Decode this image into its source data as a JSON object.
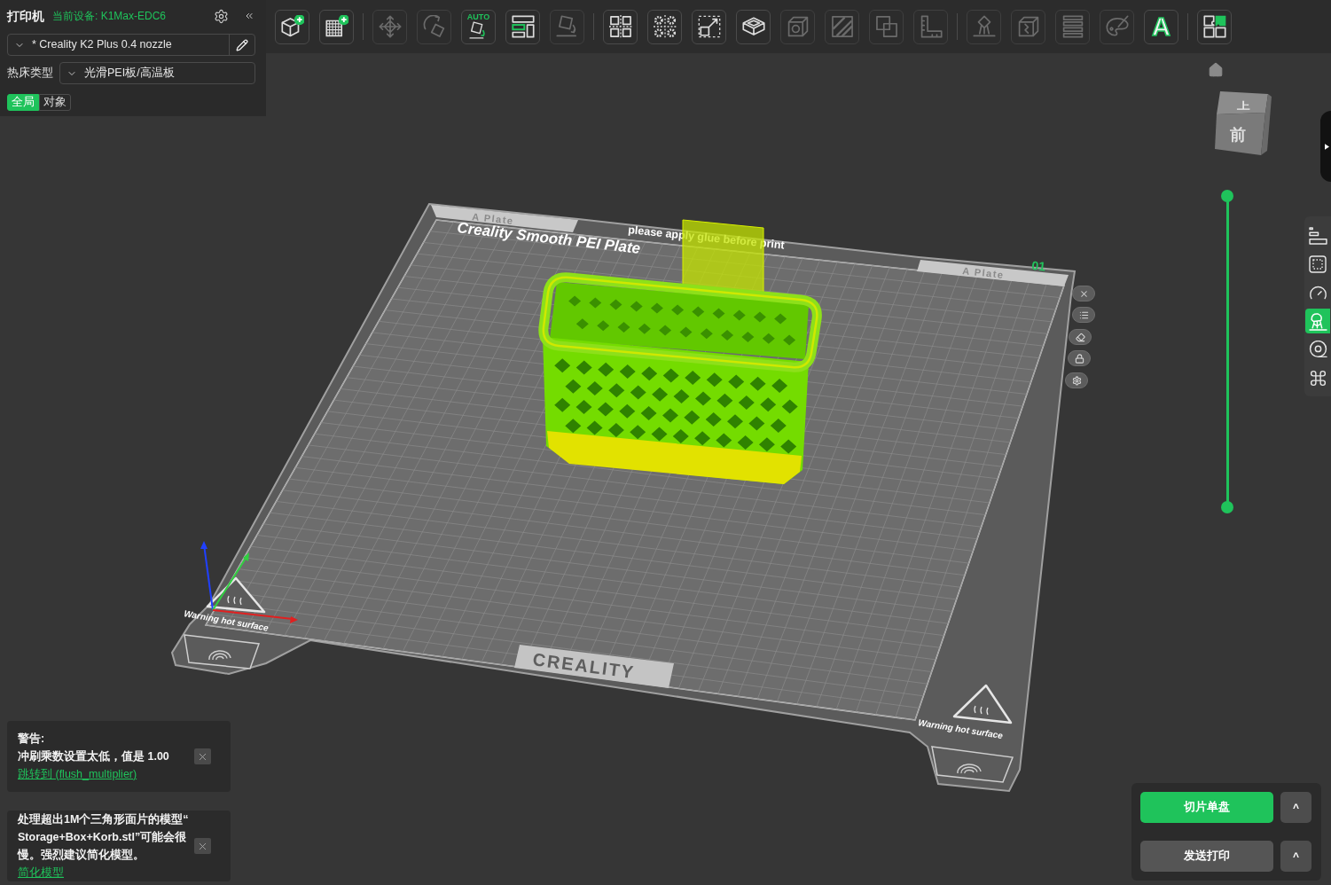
{
  "printer_panel": {
    "title": "打印机",
    "current_device": "当前设备: K1Max-EDC6",
    "preset": "* Creality K2 Plus 0.4 nozzle",
    "bed_type_label": "热床类型",
    "bed_type": "光滑PEI板/高温板",
    "scope_tabs": [
      {
        "label": "全局",
        "selected": true
      },
      {
        "label": "对象",
        "selected": false
      }
    ]
  },
  "toolbar": {
    "groups": [
      {
        "tools": [
          {
            "kind": "add-model",
            "disabled": false
          },
          {
            "kind": "add-plate",
            "disabled": false
          }
        ]
      },
      {
        "tools": [
          {
            "kind": "move",
            "disabled": true
          },
          {
            "kind": "rotate",
            "disabled": true
          },
          {
            "kind": "auto-orient",
            "label": "AUTO",
            "disabled": false
          },
          {
            "kind": "arrange",
            "disabled": false
          },
          {
            "kind": "lay-on-face",
            "disabled": true
          }
        ]
      },
      {
        "tools": [
          {
            "kind": "split-objects",
            "disabled": false
          },
          {
            "kind": "split-parts",
            "disabled": false
          },
          {
            "kind": "scale",
            "disabled": false
          },
          {
            "kind": "hollow",
            "disabled": false
          },
          {
            "kind": "cut",
            "disabled": true
          },
          {
            "kind": "hatch",
            "disabled": true
          },
          {
            "kind": "boolean",
            "disabled": true
          },
          {
            "kind": "measure",
            "disabled": true
          }
        ]
      },
      {
        "tools": [
          {
            "kind": "support",
            "disabled": true
          },
          {
            "kind": "seam",
            "disabled": true
          },
          {
            "kind": "layer-height",
            "disabled": true
          },
          {
            "kind": "paint",
            "disabled": true
          },
          {
            "kind": "text",
            "label": "A",
            "disabled": false
          }
        ]
      },
      {
        "tools": [
          {
            "kind": "assembly",
            "disabled": false
          }
        ]
      }
    ]
  },
  "viewport": {
    "plate": {
      "title": "Creality Smooth PEI Plate",
      "notice": "please apply glue before print",
      "tabs": [
        "A Plate",
        "A Plate"
      ],
      "number": "01",
      "brand": "CREALITY",
      "warnings": [
        "Warning hot surface",
        "Warning hot surface"
      ]
    },
    "view_cube": {
      "top": "上",
      "front": "前"
    },
    "layer_slider": {
      "upper": {
        "level": 1
      },
      "lower": {
        "level": 0
      }
    }
  },
  "view_tools": [
    {
      "kind": "bars",
      "selected": false
    },
    {
      "kind": "dotted-square",
      "selected": false
    },
    {
      "kind": "gauge",
      "selected": false
    },
    {
      "kind": "support",
      "selected": true
    },
    {
      "kind": "target",
      "selected": false
    },
    {
      "kind": "loops",
      "selected": false
    }
  ],
  "notifications": [
    {
      "kind": "warning",
      "title": "警告:",
      "message": "冲刷乘数设置太低，值是 1.00",
      "link": "跳转到 (flush_multiplier)"
    },
    {
      "kind": "notice",
      "message": "处理超出1M个三角形面片的模型“Storage+Box+Korb.stl”可能会很慢。强烈建议简化模型。",
      "link": "简化模型"
    }
  ],
  "actions": [
    {
      "label": "切片单盘",
      "primary": true,
      "menu": "^"
    },
    {
      "label": "发送打印",
      "primary": false,
      "menu": "^"
    }
  ]
}
